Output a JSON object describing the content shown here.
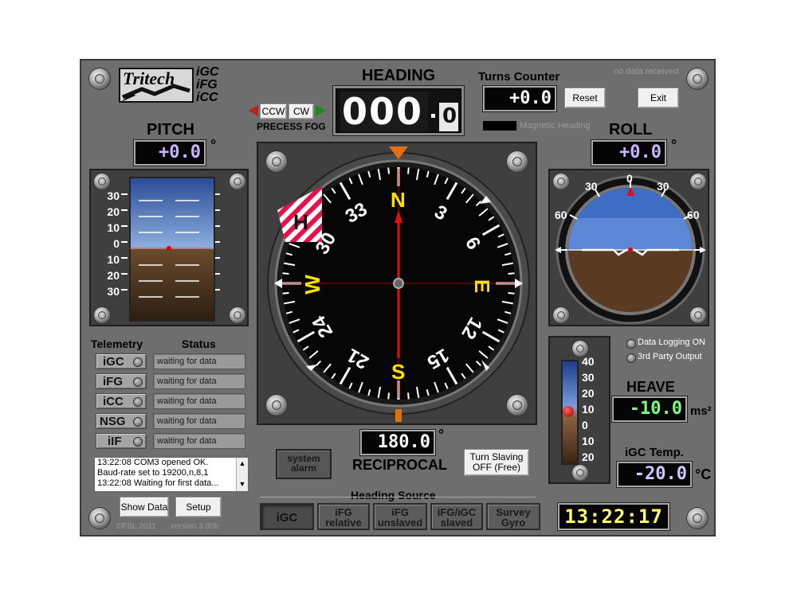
{
  "logo": {
    "brand": "Tritech",
    "products": [
      "iGC",
      "iFG",
      "iCC"
    ]
  },
  "status_text": "no data received",
  "heading": {
    "title": "HEADING",
    "value_main": "000",
    "value_dec": "0"
  },
  "fog": {
    "ccw": "CCW",
    "cw": "CW",
    "label": "PRECESS FOG"
  },
  "turns": {
    "title": "Turns Counter",
    "value": "+0.0",
    "reset": "Reset"
  },
  "exit_label": "Exit",
  "magnetic_heading_label": "Magnetic Heading",
  "pitch": {
    "title": "PITCH",
    "value": "+0.0",
    "unit": "°",
    "scale": [
      "30",
      "20",
      "10",
      "0",
      "10",
      "20",
      "30"
    ]
  },
  "roll": {
    "title": "ROLL",
    "value": "+0.0",
    "unit": "°",
    "scale": [
      "60",
      "30",
      "0",
      "30",
      "60"
    ]
  },
  "compass": {
    "cardinals": {
      "n": "N",
      "e": "E",
      "s": "S",
      "w": "W"
    },
    "numbers": [
      "3",
      "6",
      "12",
      "15",
      "21",
      "24",
      "30",
      "33"
    ],
    "flag": "H"
  },
  "reciprocal": {
    "value": "180.0",
    "unit": "°",
    "label": "RECIPROCAL"
  },
  "system_alarm": "system alarm",
  "turn_slaving": "Turn Slaving OFF (Free)",
  "heave": {
    "title": "HEAVE",
    "value": "-10.0",
    "unit": "ms²",
    "scale": [
      "40",
      "30",
      "20",
      "10",
      "0",
      "10",
      "20"
    ]
  },
  "temp": {
    "title": "iGC Temp.",
    "value": "-20.0",
    "unit": "°C"
  },
  "data_logging": "Data Logging ON",
  "third_party": "3rd Party Output",
  "telemetry": {
    "header_left": "Telemetry",
    "header_right": "Status",
    "rows": [
      {
        "name": "iGC",
        "status": "waiting for data"
      },
      {
        "name": "iFG",
        "status": "waiting for data"
      },
      {
        "name": "iCC",
        "status": "waiting for data"
      },
      {
        "name": "NSG",
        "status": "waiting for data"
      },
      {
        "name": "iIF",
        "status": "waiting for data"
      }
    ]
  },
  "log_lines": [
    "13:22:08 COM3 opened OK.",
    "Baud-rate set to 19200,n,8,1",
    "13:22:08 Waiting for first data..."
  ],
  "buttons": {
    "show_data": "Show Data",
    "setup": "Setup"
  },
  "footer": {
    "copyright": "©FSL 2011",
    "version": "version 3.00b"
  },
  "heading_source": {
    "title": "Heading Source",
    "options": [
      {
        "label": "iGC"
      },
      {
        "label": "iFG relative"
      },
      {
        "label": "iFG unslaved"
      },
      {
        "label": "iFG/iGC slaved"
      },
      {
        "label": "Survey Gyro"
      }
    ]
  },
  "clock": "13:22:17",
  "colors": {
    "panel": "#6e6e6e",
    "lcd_pitch_roll": "#c8b4ff",
    "lcd_heave": "#7dfb7d",
    "lcd_temp": "#cfc8ff",
    "clock": "#ffff66",
    "cardinal": "#ffe100"
  }
}
